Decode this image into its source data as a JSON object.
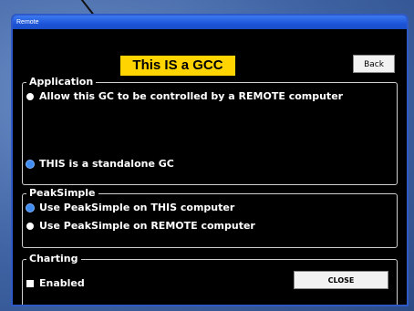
{
  "window": {
    "title": "Remote"
  },
  "header": {
    "label": "This IS a GCC"
  },
  "buttons": {
    "back": "Back",
    "close": "CLOSE"
  },
  "application": {
    "legend": "Application",
    "options": [
      {
        "label": "Allow this GC to be controlled by a REMOTE computer",
        "selected": false
      },
      {
        "label": "THIS is a standalone GC",
        "selected": true
      }
    ]
  },
  "peaksimple": {
    "legend": "PeakSimple",
    "options": [
      {
        "label": "Use PeakSimple on THIS computer",
        "selected": true
      },
      {
        "label": "Use PeakSimple on REMOTE computer",
        "selected": false
      }
    ]
  },
  "charting": {
    "legend": "Charting",
    "enabled_label": "Enabled"
  },
  "colors": {
    "header_bg": "#ffd400",
    "selected_radio": "#3f8cf2",
    "titlebar": "#1d55d8"
  }
}
